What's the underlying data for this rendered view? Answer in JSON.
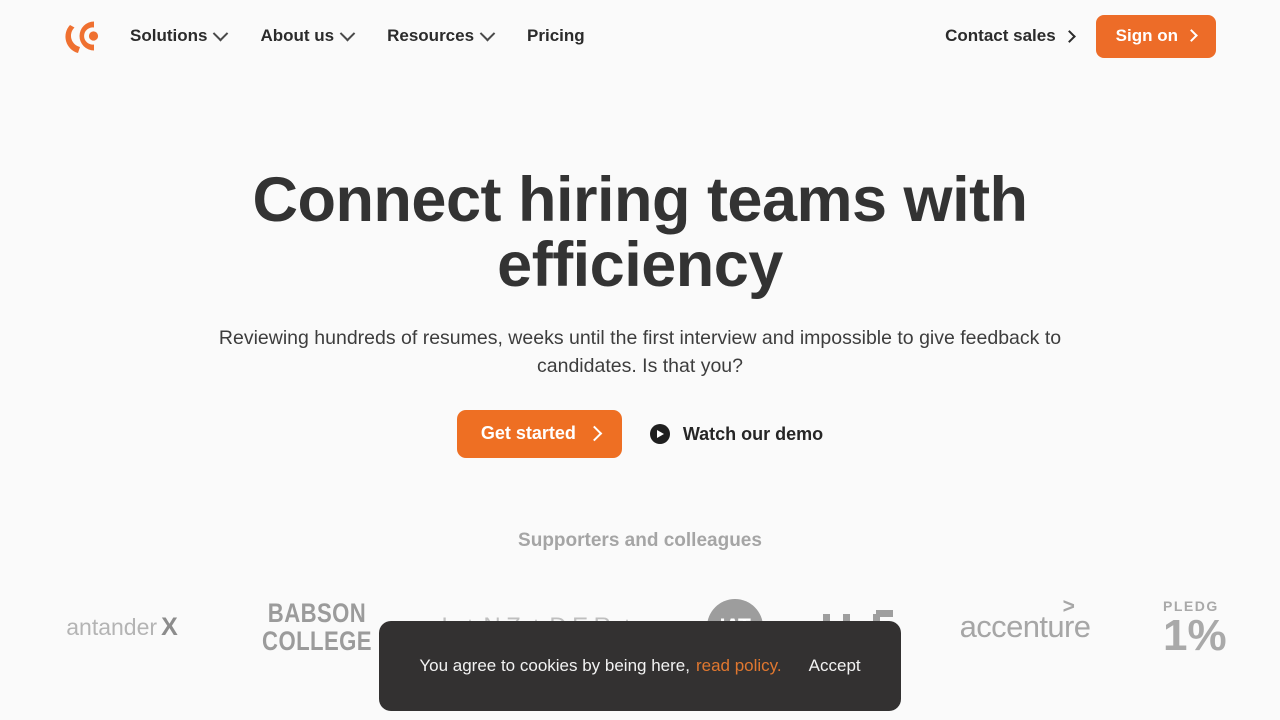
{
  "brand": {
    "logo_icon": "circular-c-logo",
    "accent_color": "#ed6c28",
    "page_background": "#fafafa"
  },
  "header": {
    "nav_items": [
      {
        "label": "Solutions",
        "has_dropdown": true
      },
      {
        "label": "About us",
        "has_dropdown": true
      },
      {
        "label": "Resources",
        "has_dropdown": true
      },
      {
        "label": "Pricing",
        "has_dropdown": false
      }
    ],
    "contact_sales": "Contact sales",
    "sign_on": "Sign on"
  },
  "hero": {
    "heading": "Connect hiring teams with efficiency",
    "subheading": "Reviewing hundreds of resumes, weeks until the first interview and impossible to give feedback to candidates. Is that you?",
    "primary_cta": "Get started",
    "secondary_cta": "Watch our demo",
    "secondary_cta_icon": "play-circle-icon"
  },
  "supporters": {
    "title": "Supporters and colleagues",
    "logos": [
      {
        "name": "santander-x",
        "text": "antander",
        "mark": "X"
      },
      {
        "name": "babson-college",
        "line1": "BABSON",
        "line2": "COLLEGE"
      },
      {
        "name": "lanzadera",
        "part1": "L",
        "part2": "NZ",
        "part3": "DER"
      },
      {
        "name": "iat",
        "text": "IAT"
      },
      {
        "name": "mit",
        "text": "MIT"
      },
      {
        "name": "accenture",
        "text": "accenture",
        "mark": ">"
      },
      {
        "name": "pledge-1-percent",
        "line1": "PLEDG",
        "line2": "1%"
      }
    ]
  },
  "cookie_banner": {
    "message": "You agree to cookies by being here,",
    "policy_link": "read policy.",
    "accept_label": "Accept",
    "background_color": "#333131",
    "link_color": "#e0772f"
  }
}
